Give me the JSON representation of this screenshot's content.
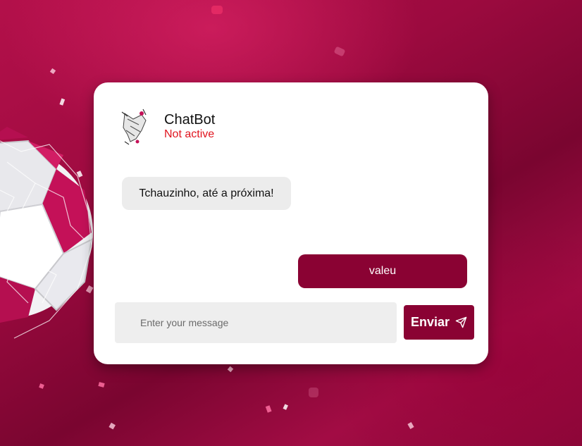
{
  "chat": {
    "bot_name": "ChatBot",
    "status": "Not active",
    "messages": [
      {
        "from": "bot",
        "text": "Tchauzinho, até a próxima!"
      },
      {
        "from": "user",
        "text": "valeu"
      }
    ]
  },
  "composer": {
    "placeholder": "Enter your message",
    "send_label": "Enviar",
    "send_icon": "paper-plane-icon"
  },
  "colors": {
    "accent": "#8a0233",
    "status": "#e0141e",
    "bot_bubble": "#ececec"
  }
}
